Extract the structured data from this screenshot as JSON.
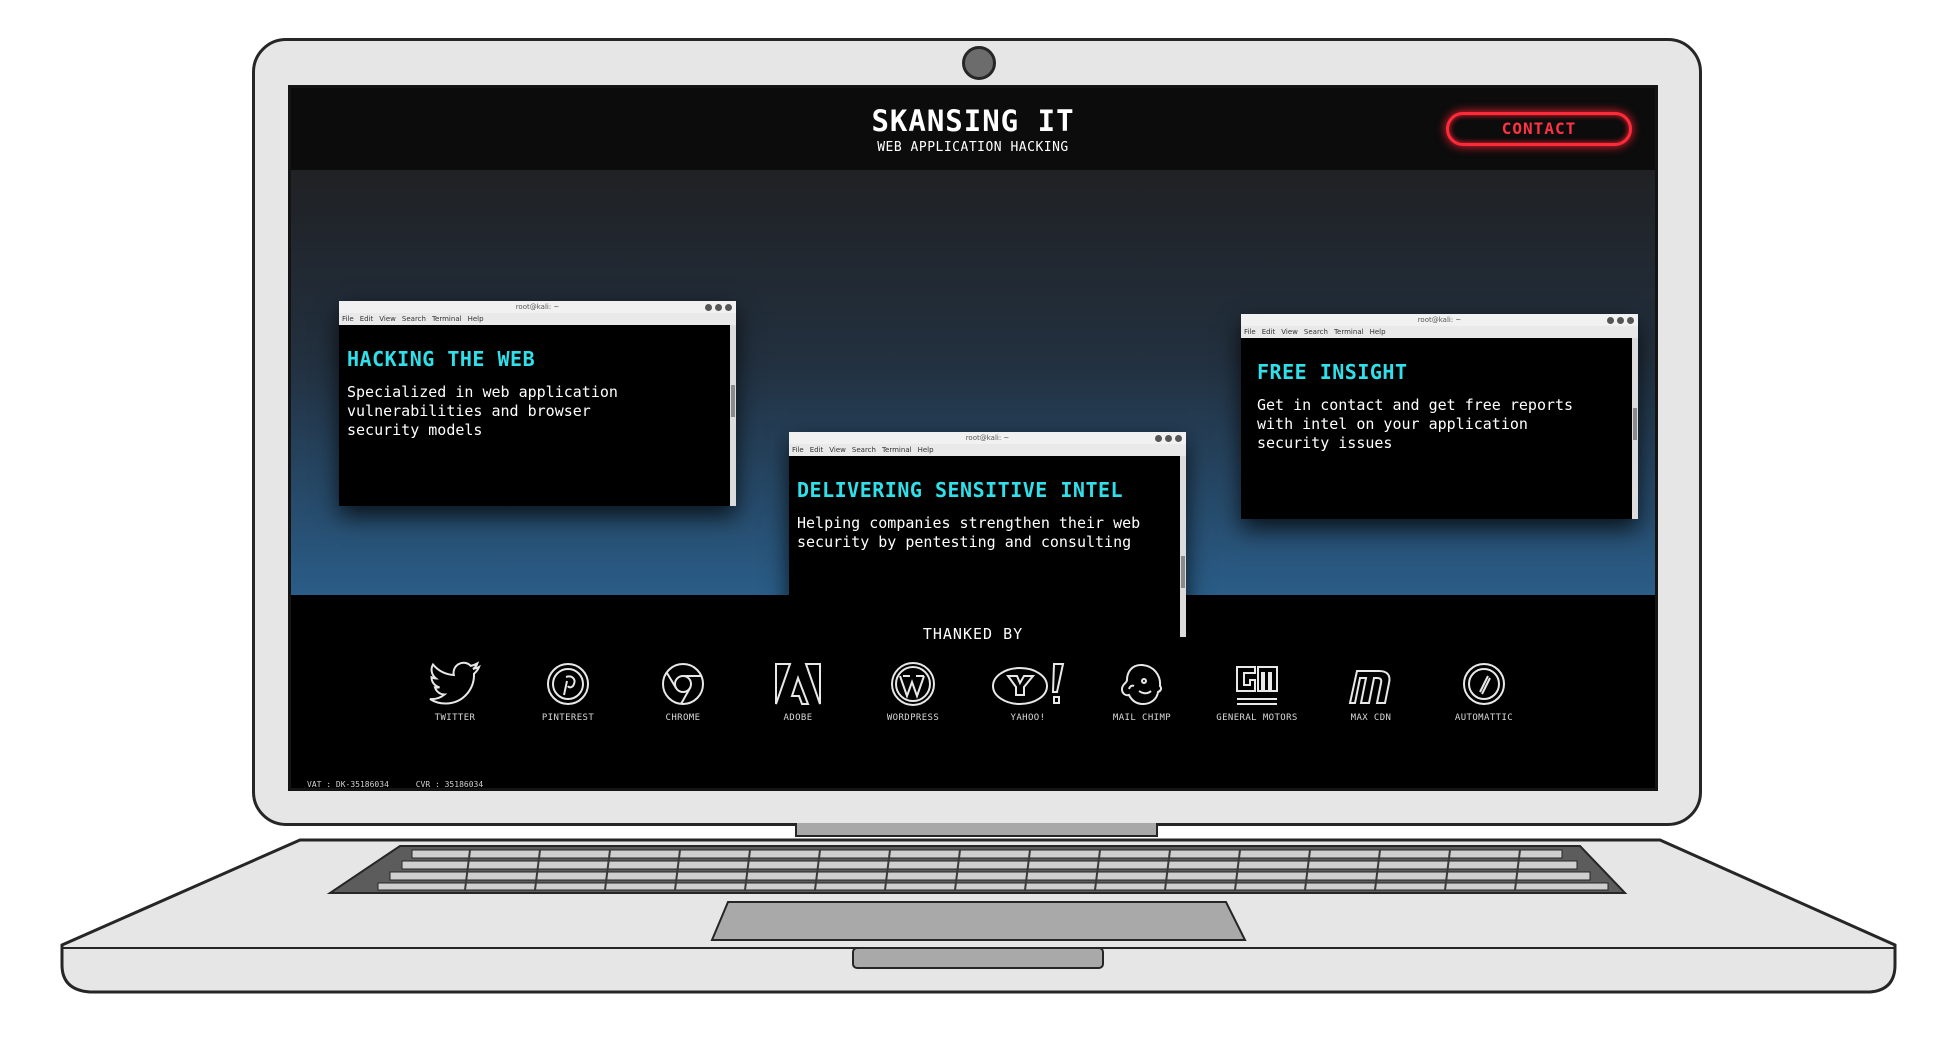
{
  "header": {
    "brand": "SKANSING IT",
    "subtitle": "WEB APPLICATION HACKING",
    "contact_label": "CONTACT"
  },
  "terminal": {
    "title": "root@kali: ~",
    "menu": [
      "File",
      "Edit",
      "View",
      "Search",
      "Terminal",
      "Help"
    ]
  },
  "cards": [
    {
      "heading": "HACKING THE WEB",
      "body": "Specialized in web application vulnerabilities and browser security models"
    },
    {
      "heading": "DELIVERING SENSITIVE INTEL",
      "body": "Helping companies strengthen their web security by pentesting and consulting"
    },
    {
      "heading": "FREE INSIGHT",
      "body": "Get in contact and get free reports with intel on your application security issues"
    }
  ],
  "thanks": {
    "title": "THANKED BY",
    "logos": [
      {
        "label": "TWITTER",
        "icon": "twitter-icon"
      },
      {
        "label": "PINTEREST",
        "icon": "pinterest-icon"
      },
      {
        "label": "CHROME",
        "icon": "chrome-icon"
      },
      {
        "label": "ADOBE",
        "icon": "adobe-icon"
      },
      {
        "label": "WORDPRESS",
        "icon": "wordpress-icon"
      },
      {
        "label": "YAHOO!",
        "icon": "yahoo-icon"
      },
      {
        "label": "MAIL CHIMP",
        "icon": "mailchimp-icon"
      },
      {
        "label": "GENERAL MOTORS",
        "icon": "gm-icon"
      },
      {
        "label": "MAX CDN",
        "icon": "maxcdn-icon"
      },
      {
        "label": "AUTOMATTIC",
        "icon": "automattic-icon"
      }
    ]
  },
  "footer": {
    "vat": "VAT : DK-35186034",
    "cvr": "CVR : 35186034"
  },
  "colors": {
    "accent_cyan": "#2fe0ea",
    "contact_red": "#ff2b3a",
    "hero_top": "#202124",
    "hero_bottom": "#2a5d88"
  }
}
